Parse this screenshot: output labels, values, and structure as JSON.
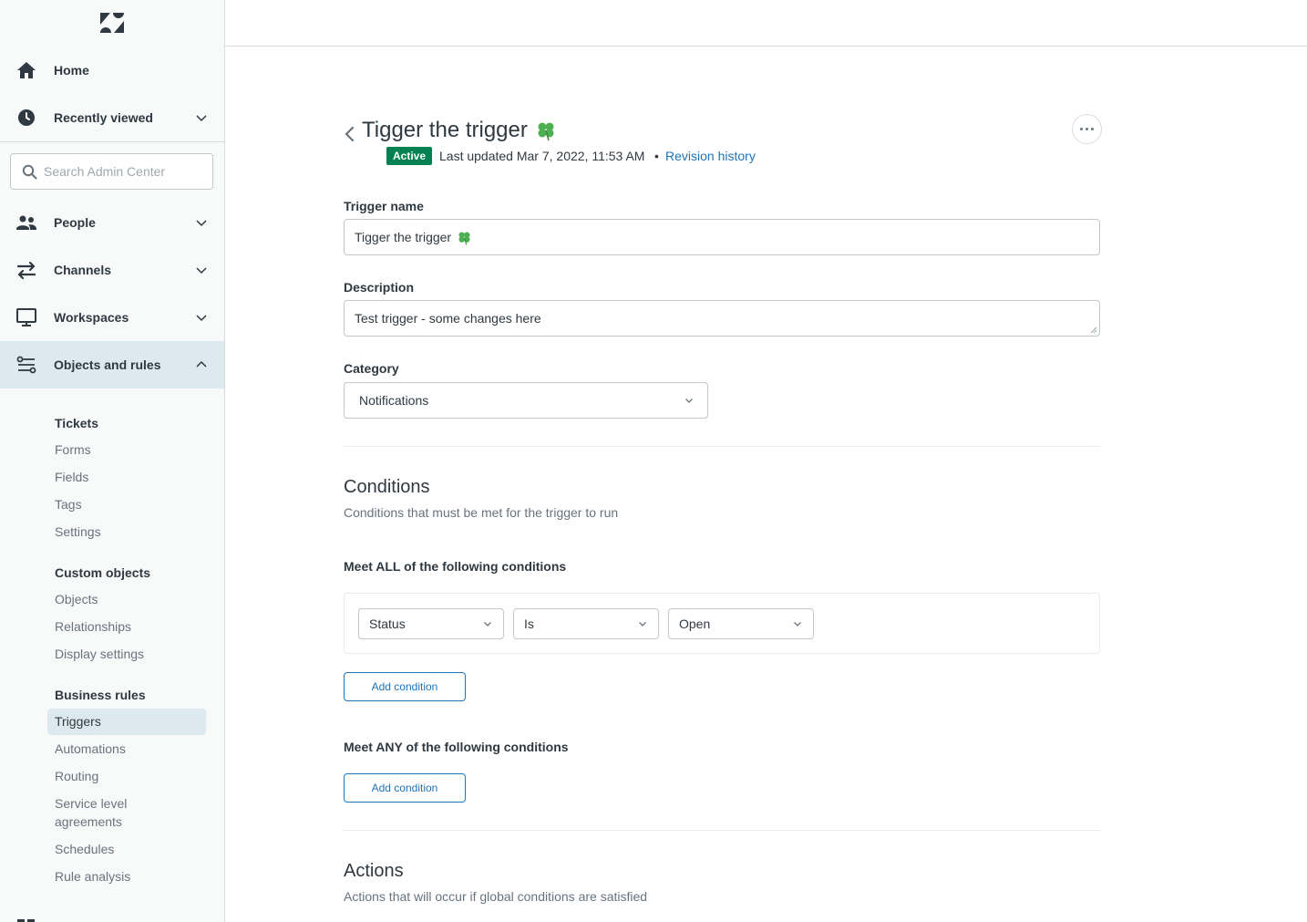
{
  "sidebar": {
    "logo": "zendesk-logo",
    "nav": [
      {
        "label": "Home",
        "icon": "home-icon"
      },
      {
        "label": "Recently viewed",
        "icon": "clock-icon"
      },
      {
        "label": "People",
        "icon": "people-icon"
      },
      {
        "label": "Channels",
        "icon": "channels-icon"
      },
      {
        "label": "Workspaces",
        "icon": "monitor-icon"
      },
      {
        "label": "Objects and rules",
        "icon": "objects-rules-icon"
      }
    ],
    "search": {
      "placeholder": "Search Admin Center"
    },
    "tickets": {
      "title": "Tickets",
      "items": [
        "Forms",
        "Fields",
        "Tags",
        "Settings"
      ]
    },
    "custom_objects": {
      "title": "Custom objects",
      "items": [
        "Objects",
        "Relationships",
        "Display settings"
      ]
    },
    "business_rules": {
      "title": "Business rules",
      "items": [
        "Triggers",
        "Automations",
        "Routing",
        "Service level",
        "agreements",
        "Schedules",
        "Rule analysis"
      ]
    }
  },
  "page": {
    "title": "Tigger the trigger",
    "status_badge": "Active",
    "last_updated": "Last updated Mar 7, 2022, 11:53 AM",
    "separator": "•",
    "revision_link": "Revision history"
  },
  "form": {
    "trigger_name_label": "Trigger name",
    "trigger_name_value": "Tigger the trigger",
    "description_label": "Description",
    "description_value": "Test trigger - some changes here",
    "category_label": "Category",
    "category_value": "Notifications"
  },
  "conditions": {
    "title": "Conditions",
    "subtitle": "Conditions that must be met for the trigger to run",
    "all_heading": "Meet ALL of the following conditions",
    "all_row": {
      "field": "Status",
      "operator": "Is",
      "value": "Open"
    },
    "add_condition_label": "Add condition",
    "any_heading": "Meet ANY of the following conditions"
  },
  "actions": {
    "title": "Actions",
    "subtitle": "Actions that will occur if global conditions are satisfied"
  },
  "colors": {
    "accent": "#1f73b7",
    "active_badge": "#038153",
    "selected_bg": "#dce9ee",
    "clover": "#4caf50"
  }
}
